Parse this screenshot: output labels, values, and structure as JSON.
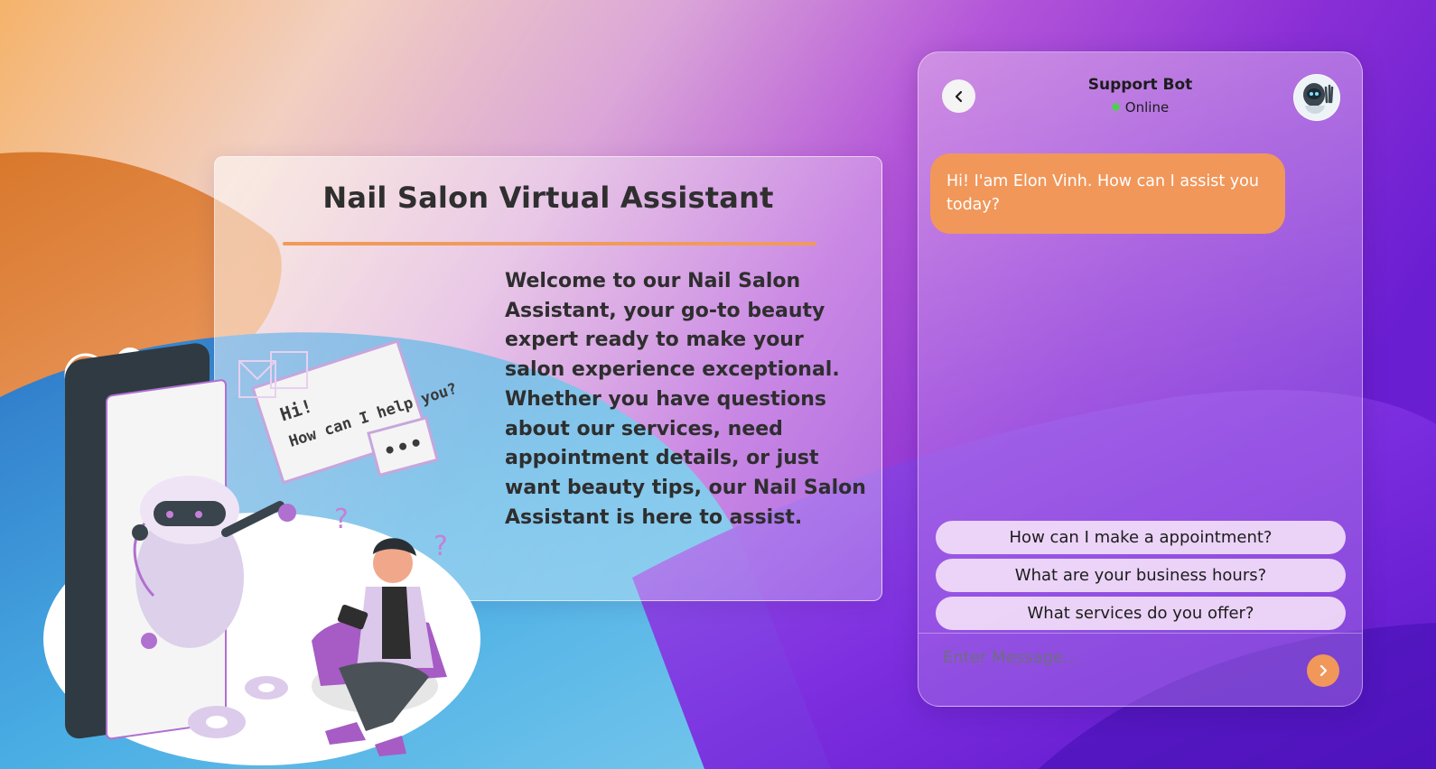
{
  "colors": {
    "accent": "#f1975a",
    "online": "#58c85a",
    "text_dark": "#2e2e2e",
    "chip_bg": "#f5e1fa"
  },
  "info_card": {
    "title": "Nail Salon Virtual Assistant",
    "description": "Welcome to our Nail Salon Assistant, your go-to beauty expert ready to make your salon experience exceptional. Whether you have questions about our services, need appointment details, or just want beauty tips, our Nail Salon Assistant is here to assist."
  },
  "illustration": {
    "bubble_line1": "Hi!",
    "bubble_line2": "How can I help you?",
    "icons": [
      "gear-icon",
      "envelope-icon",
      "robot",
      "person"
    ]
  },
  "chat": {
    "bot_name": "Support Bot",
    "status": "Online",
    "back_icon": "chevron-left-icon",
    "avatar_icon": "robot-avatar",
    "messages": [
      {
        "from": "bot",
        "text": "Hi! I'am Elon Vinh. How can I assist you today?"
      }
    ],
    "suggestions": [
      "How can I make a appointment?",
      "What are your business hours?",
      "What services do you offer?"
    ],
    "input_placeholder": "Enter Message...",
    "send_icon": "chevron-right-icon"
  }
}
